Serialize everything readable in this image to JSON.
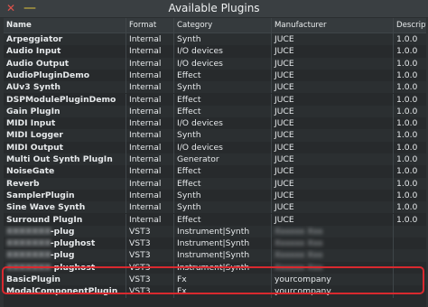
{
  "window": {
    "title": "Available Plugins",
    "close_glyph": "✕",
    "minimize_glyph": "—"
  },
  "columns": [
    "Name",
    "Format",
    "Category",
    "Manufacturer",
    "Description"
  ],
  "rows": [
    {
      "name": "Arpeggiator",
      "format": "Internal",
      "category": "Synth",
      "manufacturer": "JUCE",
      "description": "1.0.0"
    },
    {
      "name": "Audio Input",
      "format": "Internal",
      "category": "I/O devices",
      "manufacturer": "JUCE",
      "description": "1.0.0"
    },
    {
      "name": "Audio Output",
      "format": "Internal",
      "category": "I/O devices",
      "manufacturer": "JUCE",
      "description": "1.0.0"
    },
    {
      "name": "AudioPluginDemo",
      "format": "Internal",
      "category": "Effect",
      "manufacturer": "JUCE",
      "description": "1.0.0"
    },
    {
      "name": "AUv3 Synth",
      "format": "Internal",
      "category": "Synth",
      "manufacturer": "JUCE",
      "description": "1.0.0"
    },
    {
      "name": "DSPModulePluginDemo",
      "format": "Internal",
      "category": "Effect",
      "manufacturer": "JUCE",
      "description": "1.0.0"
    },
    {
      "name": "Gain PlugIn",
      "format": "Internal",
      "category": "Effect",
      "manufacturer": "JUCE",
      "description": "1.0.0"
    },
    {
      "name": "MIDI Input",
      "format": "Internal",
      "category": "I/O devices",
      "manufacturer": "JUCE",
      "description": "1.0.0"
    },
    {
      "name": "MIDI Logger",
      "format": "Internal",
      "category": "Synth",
      "manufacturer": "JUCE",
      "description": "1.0.0"
    },
    {
      "name": "MIDI Output",
      "format": "Internal",
      "category": "I/O devices",
      "manufacturer": "JUCE",
      "description": "1.0.0"
    },
    {
      "name": "Multi Out Synth PlugIn",
      "format": "Internal",
      "category": "Generator",
      "manufacturer": "JUCE",
      "description": "1.0.0"
    },
    {
      "name": "NoiseGate",
      "format": "Internal",
      "category": "Effect",
      "manufacturer": "JUCE",
      "description": "1.0.0"
    },
    {
      "name": "Reverb",
      "format": "Internal",
      "category": "Effect",
      "manufacturer": "JUCE",
      "description": "1.0.0"
    },
    {
      "name": "SamplerPlugin",
      "format": "Internal",
      "category": "Synth",
      "manufacturer": "JUCE",
      "description": "1.0.0"
    },
    {
      "name": "Sine Wave Synth",
      "format": "Internal",
      "category": "Synth",
      "manufacturer": "JUCE",
      "description": "1.0.0"
    },
    {
      "name": "Surround PlugIn",
      "format": "Internal",
      "category": "Effect",
      "manufacturer": "JUCE",
      "description": "1.0.0"
    },
    {
      "name_blurred": "XXXXXXX",
      "name": "-plug",
      "format": "VST3",
      "category": "Instrument|Synth",
      "manufacturer_blurred": "Xxxxxx Xxx",
      "manufacturer": "",
      "description": ""
    },
    {
      "name_blurred": "XXXXXXX",
      "name": "-plughost",
      "format": "VST3",
      "category": "Instrument|Synth",
      "manufacturer_blurred": "Xxxxxx Xxx",
      "manufacturer": "",
      "description": ""
    },
    {
      "name_blurred": "XXXXXXX",
      "name": "-plug",
      "format": "VST3",
      "category": "Instrument|Synth",
      "manufacturer_blurred": "Xxxxxx Xxx",
      "manufacturer": "",
      "description": ""
    },
    {
      "name_blurred": "XXXXXXX",
      "name": "-plughost",
      "format": "VST3",
      "category": "Instrument|Synth",
      "manufacturer_blurred": "Xxxxxx Xxx",
      "manufacturer": "",
      "description": ""
    },
    {
      "name": "BasicPlugin",
      "format": "VST3",
      "category": "Fx",
      "manufacturer": "yourcompany",
      "description": ""
    },
    {
      "name": "ModalComponentPlugin",
      "format": "VST3",
      "category": "Fx",
      "manufacturer": "yourcompany",
      "description": ""
    }
  ],
  "colors": {
    "highlight_border": "#d9292f",
    "window_bg": "#2e3234",
    "row_even": "#2b2f31",
    "row_odd": "#272a2c"
  }
}
